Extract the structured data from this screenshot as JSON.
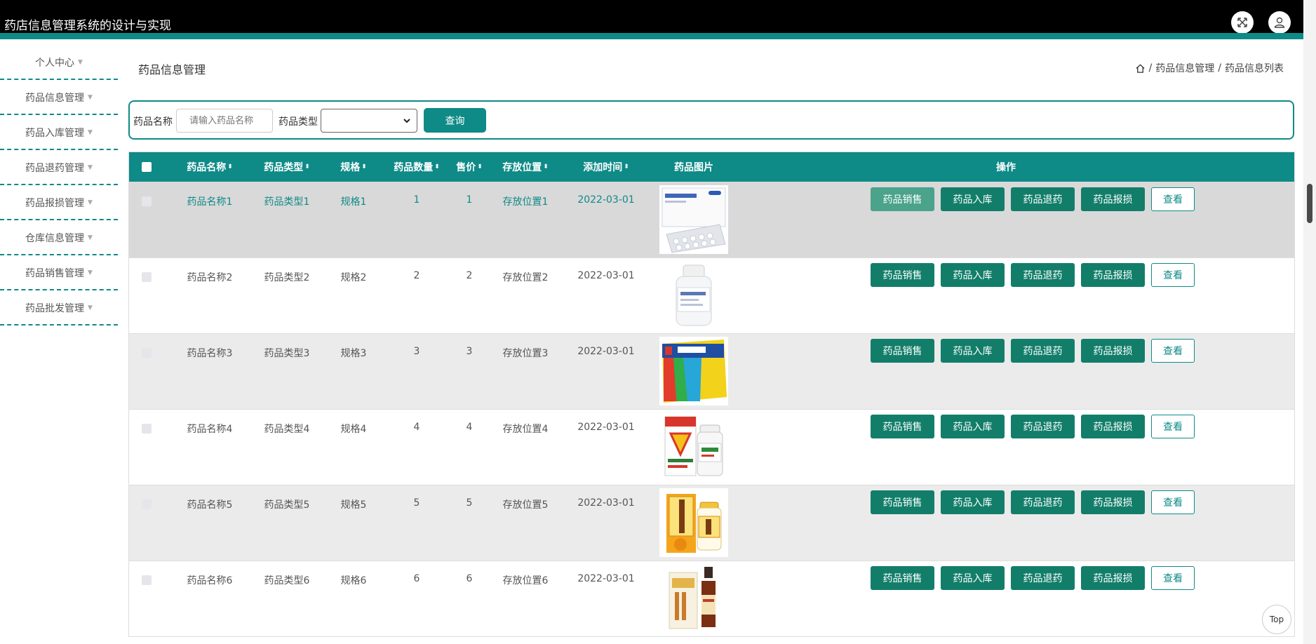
{
  "app_title": "药店信息管理系统的设计与实现",
  "icons": {
    "fullscreen": "expand-arrows-icon",
    "user": "user-icon",
    "home": "home-icon"
  },
  "sidebar": {
    "items": [
      {
        "label": "个人中心"
      },
      {
        "label": "药品信息管理"
      },
      {
        "label": "药品入库管理"
      },
      {
        "label": "药品退药管理"
      },
      {
        "label": "药品报损管理"
      },
      {
        "label": "仓库信息管理"
      },
      {
        "label": "药品销售管理"
      },
      {
        "label": "药品批发管理"
      }
    ]
  },
  "page_title": "药品信息管理",
  "breadcrumb": {
    "items": [
      "药品信息管理",
      "药品信息列表"
    ],
    "separator": "/"
  },
  "search": {
    "name_label": "药品名称",
    "name_placeholder": "请输入药品名称",
    "type_label": "药品类型",
    "type_value": "",
    "button": "查询"
  },
  "table": {
    "headers": {
      "name": "药品名称",
      "type": "药品类型",
      "spec": "规格",
      "qty": "药品数量",
      "price": "售价",
      "location": "存放位置",
      "date": "添加时间",
      "image": "药品图片",
      "ops": "操作"
    },
    "sort_glyph": "⬍",
    "rows": [
      {
        "name": "药品名称1",
        "type": "药品类型1",
        "spec": "规格1",
        "qty": "1",
        "price": "1",
        "location": "存放位置1",
        "date": "2022-03-01",
        "image": "white-pill-blister-box"
      },
      {
        "name": "药品名称2",
        "type": "药品类型2",
        "spec": "规格2",
        "qty": "2",
        "price": "2",
        "location": "存放位置2",
        "date": "2022-03-01",
        "image": "white-medicine-bottle"
      },
      {
        "name": "药品名称3",
        "type": "药品类型3",
        "spec": "规格3",
        "qty": "3",
        "price": "3",
        "location": "存放位置3",
        "date": "2022-03-01",
        "image": "yellow-tablet-box"
      },
      {
        "name": "药品名称4",
        "type": "药品类型4",
        "spec": "规格4",
        "qty": "4",
        "price": "4",
        "location": "存放位置4",
        "date": "2022-03-01",
        "image": "vitamin-c-box-and-bottle"
      },
      {
        "name": "药品名称5",
        "type": "药品类型5",
        "spec": "规格5",
        "qty": "5",
        "price": "5",
        "location": "存放位置5",
        "date": "2022-03-01",
        "image": "orange-herbal-pill-box"
      },
      {
        "name": "药品名称6",
        "type": "药品类型6",
        "spec": "规格6",
        "qty": "6",
        "price": "6",
        "location": "存放位置6",
        "date": "2022-03-01",
        "image": "syrup-bottle-and-box"
      }
    ],
    "actions": {
      "sell": "药品销售",
      "stock_in": "药品入库",
      "return": "药品退药",
      "damage": "药品报损",
      "view": "查看"
    }
  },
  "top_button": "Top",
  "colors": {
    "primary": "#0e8a87",
    "button": "#127e6a",
    "topbar": "#000000",
    "highlight_row": "#d9d9d9",
    "alt_row": "#ebebeb"
  }
}
